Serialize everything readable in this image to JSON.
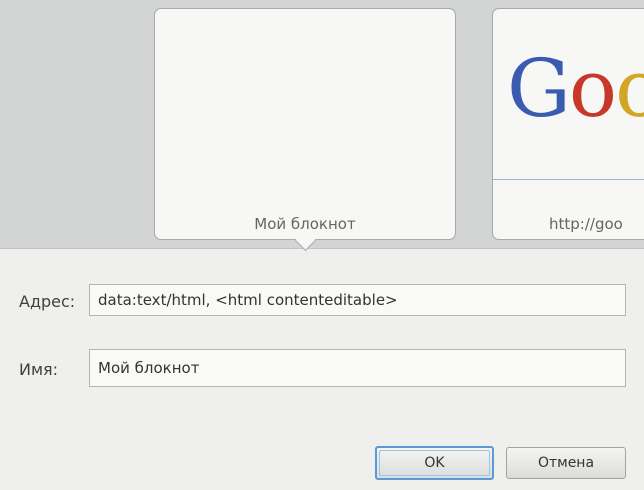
{
  "thumbnails": [
    {
      "caption": "Мой блокнот"
    },
    {
      "caption": "http://goo",
      "logo_letters": [
        "G",
        "o",
        "o"
      ]
    }
  ],
  "form": {
    "address_label": "Адрес:",
    "address_value": "data:text/html, <html contenteditable>",
    "name_label": "Имя:",
    "name_value": "Мой блокнот"
  },
  "buttons": {
    "ok_label": "OK",
    "cancel_label": "Отмена"
  },
  "colors": {
    "focus_border": "#5c9ad6",
    "google_blue": "#3b5bb0",
    "google_red": "#c7382a",
    "google_yellow": "#d2a624"
  }
}
